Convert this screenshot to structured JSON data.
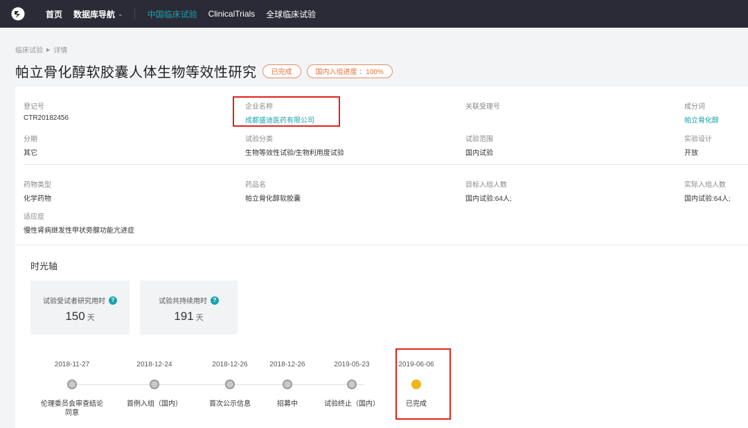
{
  "nav": {
    "items": [
      {
        "label": "首页"
      },
      {
        "label": "数据库导航",
        "chevron": "⌄"
      },
      {
        "label": "中国临床试验"
      },
      {
        "label": "ClinicalTrials"
      },
      {
        "label": "全球临床试验"
      }
    ],
    "active_index": 2,
    "active_color": "#1aa3ad"
  },
  "breadcrumb": {
    "items": [
      "临床试验",
      "详情"
    ]
  },
  "header": {
    "title": "帕立骨化醇软胶囊人体生物等效性研究",
    "badges": [
      "已完成",
      "国内入组进度 ：100%"
    ]
  },
  "info": {
    "registration_no": {
      "label": "登记号",
      "value": "CTR20182456"
    },
    "company": {
      "label": "企业名称",
      "value": "成都盛迪医药有限公司"
    },
    "acceptance_no": {
      "label": "关联受理号",
      "value": ""
    },
    "ingredient": {
      "label": "成分词",
      "value": "帕立骨化醇"
    },
    "phase": {
      "label": "分期",
      "value": "其它"
    },
    "category": {
      "label": "试验分类",
      "value": "生物等效性试验/生物利用度试验"
    },
    "scope": {
      "label": "试验范围",
      "value": "国内试验"
    },
    "design": {
      "label": "实验设计",
      "value": "开放"
    },
    "drug_type": {
      "label": "药物类型",
      "value": "化学药物"
    },
    "drug_name": {
      "label": "药品名",
      "value": "帕立骨化醇软胶囊"
    },
    "target_enroll": {
      "label": "目标入组人数",
      "value": "国内试验:64人;"
    },
    "actual_enroll": {
      "label": "实际入组人数",
      "value": "国内试验:64人;"
    },
    "indication": {
      "label": "适应症",
      "value": "慢性肾病继发性甲状旁腺功能亢进症"
    }
  },
  "timeline": {
    "title": "时光轴",
    "stats": [
      {
        "label": "试验受试者研究用时",
        "value": "150",
        "unit": "天"
      },
      {
        "label": "试验共持续用时",
        "value": "191",
        "unit": "天"
      }
    ],
    "steps": [
      {
        "date": "2018-11-27",
        "label": "伦理委员会审查结论同意"
      },
      {
        "date": "2018-12-24",
        "label": "首例入组（国内）"
      },
      {
        "date": "2018-12-26",
        "label": "首次公示信息"
      },
      {
        "date": "2018-12-26",
        "label": "招募中"
      },
      {
        "date": "2019-05-23",
        "label": "试验终止（国内）"
      },
      {
        "date": "2019-06-06",
        "label": "已完成"
      }
    ],
    "current_index": 5
  }
}
